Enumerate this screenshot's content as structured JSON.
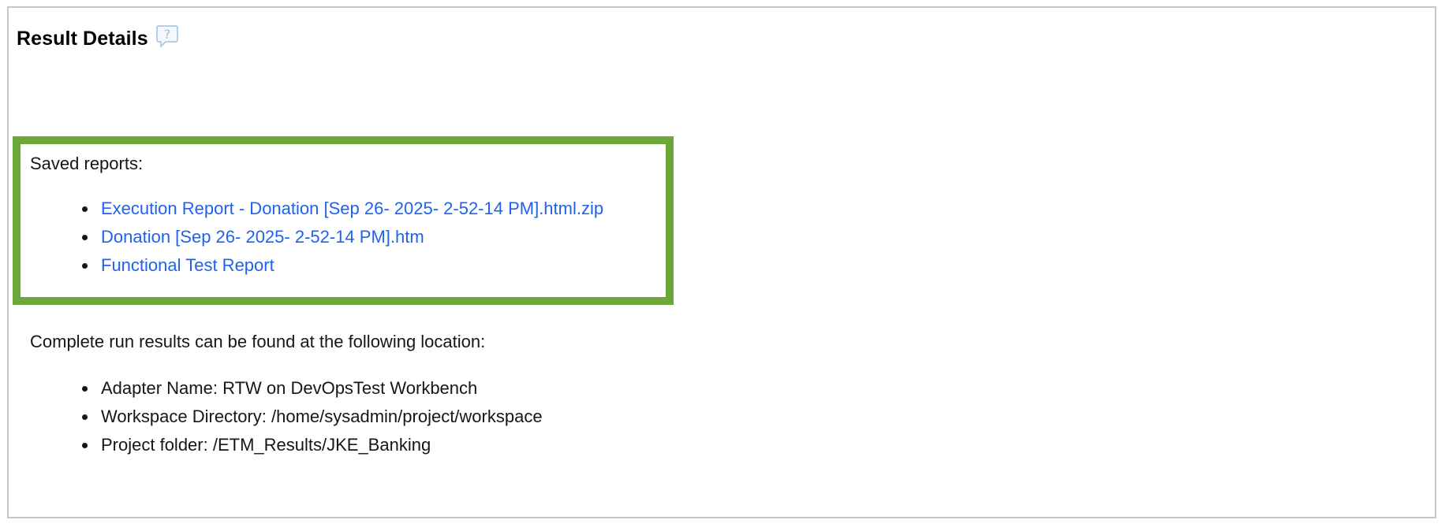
{
  "header": {
    "title": "Result Details",
    "help_icon": "help-question-icon"
  },
  "saved_reports": {
    "label": "Saved reports:",
    "items": [
      {
        "label": "Execution Report - Donation [Sep 26- 2025- 2-52-14 PM].html.zip"
      },
      {
        "label": "Donation [Sep 26- 2025- 2-52-14 PM].htm"
      },
      {
        "label": "Functional Test Report"
      }
    ],
    "highlight_color": "#6aa83a",
    "link_color": "#1f62f0"
  },
  "run_location": {
    "intro": "Complete run results can be found at the following location:",
    "items": [
      {
        "label": "Adapter Name: RTW on DevOpsTest Workbench"
      },
      {
        "label": "Workspace Directory: /home/sysadmin/project/workspace"
      },
      {
        "label": "Project folder: /ETM_Results/JKE_Banking"
      }
    ]
  }
}
